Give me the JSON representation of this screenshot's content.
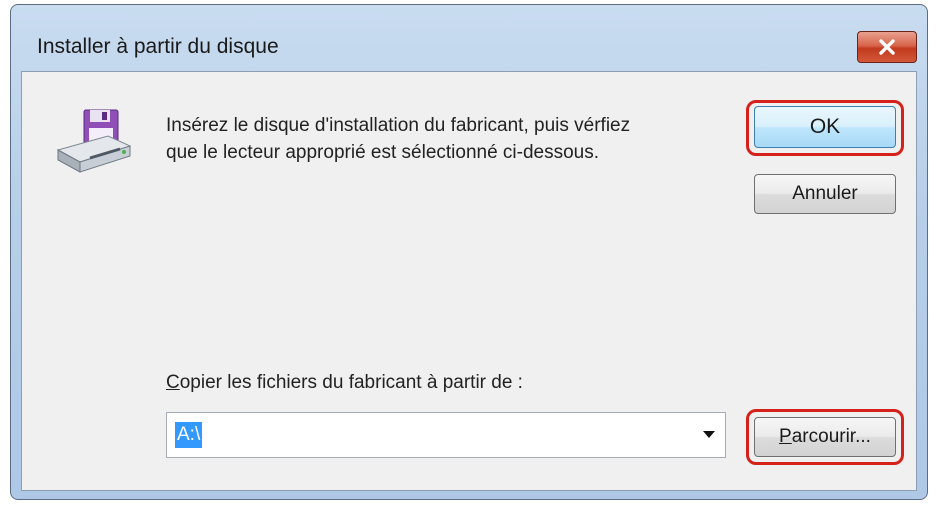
{
  "window": {
    "title": "Installer à partir du disque"
  },
  "message": {
    "line1": "Insérez le disque d'installation du fabricant, puis vérfiez",
    "line2": "que le lecteur approprié est sélectionné ci-dessous."
  },
  "buttons": {
    "ok": "OK",
    "cancel": "Annuler",
    "browse_mnemonic": "P",
    "browse_rest": "arcourir..."
  },
  "copy_from": {
    "label_mnemonic": "C",
    "label_rest": "opier les fichiers du fabricant à partir de :",
    "value": "A:\\"
  },
  "icons": {
    "close": "close-icon",
    "disk": "floppy-drive-icon",
    "dropdown": "chevron-down-icon"
  },
  "colors": {
    "highlight_ring": "#d4221b",
    "close_button": "#c23a1e",
    "selection": "#3399ff"
  }
}
